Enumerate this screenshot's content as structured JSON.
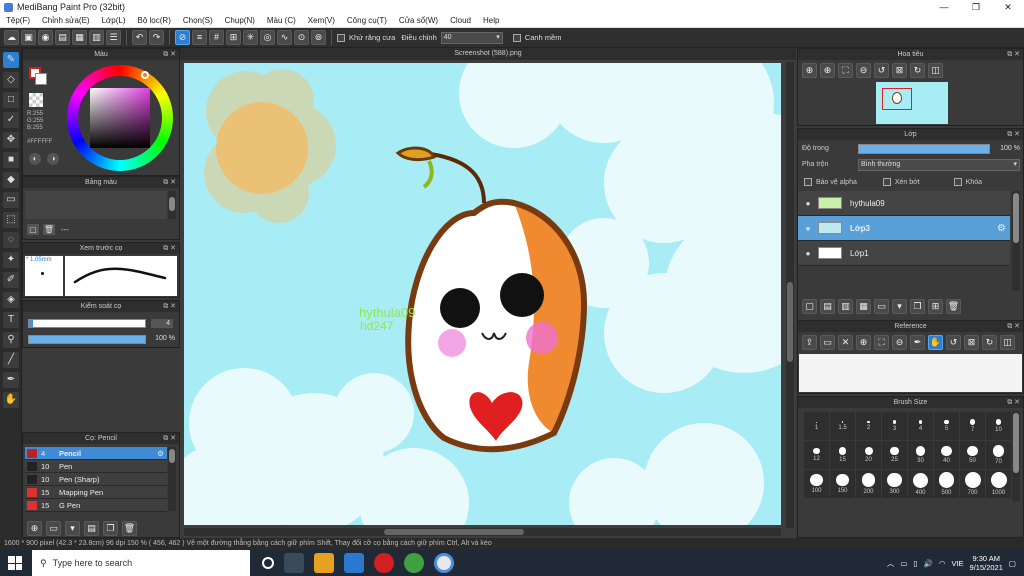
{
  "window": {
    "title": "MediBang Paint Pro (32bit)",
    "min": "—",
    "max": "❐",
    "close": "✕"
  },
  "menu": [
    "Tệp(F)",
    "Chỉnh sửa(E)",
    "Lớp(L)",
    "Bộ lọc(R)",
    "Chọn(S)",
    "Chụp(N)",
    "Màu (C)",
    "Xem(V)",
    "Công cụ(T)",
    "Cửa sổ(W)",
    "Cloud",
    "Help"
  ],
  "toolbar": {
    "antialias_label": "Khử răng cưa",
    "adjust_label": "Điều chỉnh",
    "adjust_value": "40",
    "snap_label": "Canh mềm"
  },
  "panels": {
    "color": {
      "title": "Màu",
      "rgb": "R:255\nG:255\nB:255",
      "hex": "#FFFFFF"
    },
    "palette": {
      "title": "Bảng màu",
      "dash": "---"
    },
    "brush_preview": {
      "title": "Xem trước cọ",
      "size": "* 1.05mm"
    },
    "brush_control": {
      "title": "Kiểm soát cọ",
      "size_value": "4",
      "opacity_value": "100 %"
    },
    "brush_list": {
      "title": "Cọ: Pencil",
      "items": [
        {
          "size": "4",
          "name": "Pencil",
          "color": "#c02020"
        },
        {
          "size": "10",
          "name": "Pen",
          "color": "#222222"
        },
        {
          "size": "10",
          "name": "Pen (Sharp)",
          "color": "#222222"
        },
        {
          "size": "15",
          "name": "Mapping Pen",
          "color": "#e03030"
        },
        {
          "size": "15",
          "name": "G Pen",
          "color": "#e03030"
        }
      ]
    },
    "navigator": {
      "title": "Hoa tiêu"
    },
    "layer": {
      "title": "Lớp",
      "opacity_label": "Độ trong",
      "opacity_value": "100 %",
      "blend_label": "Pha trộn",
      "blend_value": "Bình thường",
      "protect_alpha": "Bảo vệ alpha",
      "clip": "Xén bớt",
      "lock": "Khóa",
      "layers": [
        {
          "name": "hythula09"
        },
        {
          "name": "Lớp3"
        },
        {
          "name": "Lớp1"
        }
      ]
    },
    "reference": {
      "title": "Reference"
    },
    "brush_size": {
      "title": "Brush Size",
      "sizes": [
        "1",
        "1.5",
        "2",
        "3",
        "4",
        "5",
        "7",
        "10",
        "12",
        "15",
        "20",
        "25",
        "30",
        "40",
        "50",
        "70",
        "100",
        "150",
        "200",
        "300",
        "400",
        "500",
        "700",
        "1000"
      ]
    }
  },
  "canvas": {
    "tab": "Screenshot (588).png",
    "watermark1": "hythula09",
    "watermark2": "hd247"
  },
  "status": "1600 * 900 pixel   (42.3 * 23.8cm)   96 dpi   150 %   ( 456, 462 )   Vẽ một đường thẳng bằng cách giữ phím Shift, Thay đổi cỡ cọ bằng cách giữ phím Ctrl, Alt và kéo",
  "taskbar": {
    "search_placeholder": "Type here to search",
    "lang": "VIE",
    "time": "9:30 AM",
    "date": "9/15/2021"
  }
}
